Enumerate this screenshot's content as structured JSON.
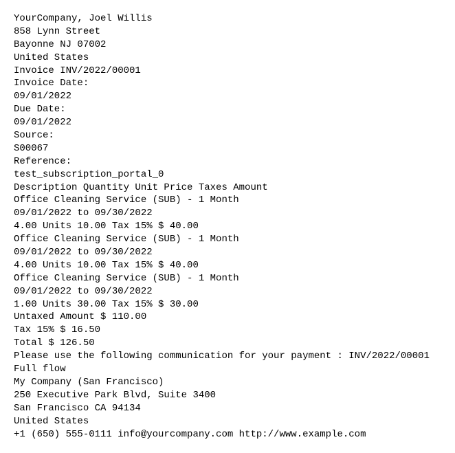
{
  "customer": {
    "line1": "YourCompany, Joel Willis",
    "street": "858 Lynn Street",
    "city_state_zip": "Bayonne NJ 07002",
    "country": "United States"
  },
  "invoice_title": "Invoice INV/2022/00001",
  "labels": {
    "invoice_date": "Invoice Date:",
    "due_date": "Due Date:",
    "source": "Source:",
    "reference": "Reference:"
  },
  "invoice_date": "09/01/2022",
  "due_date": "09/01/2022",
  "source": "S00067",
  "reference": "test_subscription_portal_0",
  "table_header": "Description Quantity Unit Price Taxes Amount",
  "lines": [
    {
      "desc": "Office Cleaning Service (SUB) - 1 Month",
      "period": "09/01/2022 to 09/30/2022",
      "detail": "4.00 Units 10.00 Tax 15% $ 40.00"
    },
    {
      "desc": "Office Cleaning Service (SUB) - 1 Month",
      "period": "09/01/2022 to 09/30/2022",
      "detail": "4.00 Units 10.00 Tax 15% $ 40.00"
    },
    {
      "desc": "Office Cleaning Service (SUB) - 1 Month",
      "period": "09/01/2022 to 09/30/2022",
      "detail": "1.00 Units 30.00 Tax 15% $ 30.00"
    }
  ],
  "totals": {
    "untaxed": "Untaxed Amount $ 110.00",
    "tax": "Tax 15% $ 16.50",
    "total": "Total $ 126.50"
  },
  "payment_communication": "Please use the following communication for your payment : INV/2022/00001",
  "flow": "Full flow",
  "company": {
    "name": "My Company (San Francisco)",
    "street": "250 Executive Park Blvd, Suite 3400",
    "city_state_zip": "San Francisco CA 94134",
    "country": "United States",
    "contact": "+1 (650) 555-0111 info@yourcompany.com http://www.example.com"
  }
}
